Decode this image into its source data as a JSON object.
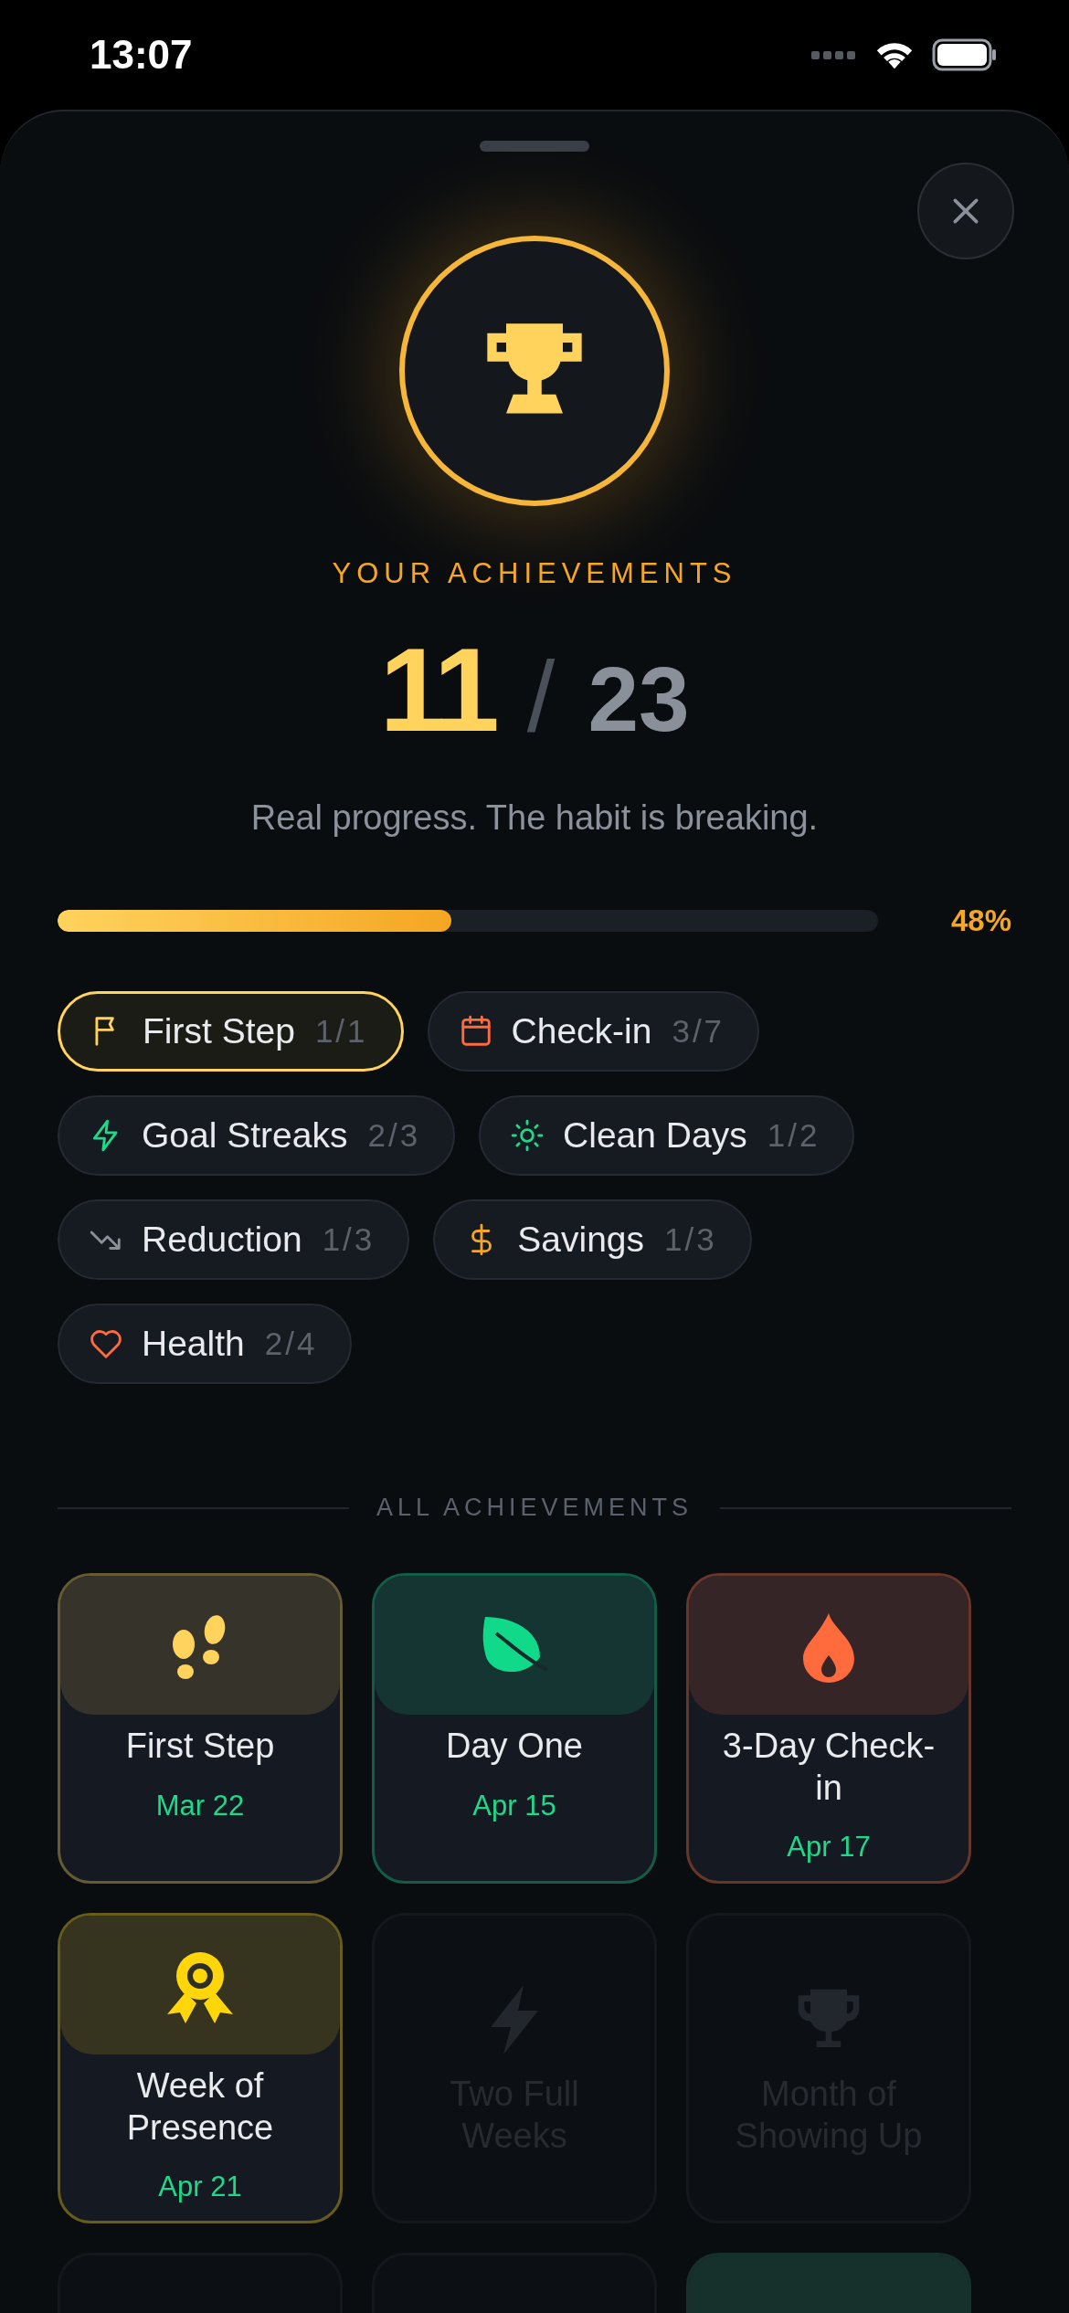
{
  "status_bar": {
    "time": "13:07"
  },
  "header": {
    "title": "YOUR ACHIEVEMENTS",
    "earned": "11",
    "separator": "/",
    "total": "23",
    "subtitle": "Real progress. The habit is breaking."
  },
  "progress": {
    "level": 0.48,
    "reading": "48%"
  },
  "categories": [
    {
      "label": "First Step",
      "count": "1/1",
      "selected": true,
      "color": "#ffd35c"
    },
    {
      "label": "Check-in",
      "count": "3/7",
      "selected": false,
      "color": "#ff6b3d"
    },
    {
      "label": "Goal Streaks",
      "count": "2/3",
      "selected": false,
      "color": "#1ed98a"
    },
    {
      "label": "Clean Days",
      "count": "1/2",
      "selected": false,
      "color": "#1ed98a"
    },
    {
      "label": "Reduction",
      "count": "1/3",
      "selected": false,
      "color": "#8a909a"
    },
    {
      "label": "Savings",
      "count": "1/3",
      "selected": false,
      "color": "#f5a623"
    },
    {
      "label": "Health",
      "count": "2/4",
      "selected": false,
      "color": "#ff6b3d"
    }
  ],
  "section_title": "ALL ACHIEVEMENTS",
  "achievements": [
    {
      "title": "First Step",
      "date": "Mar 22",
      "unlocked": true,
      "color": "#ffd35c"
    },
    {
      "title": "Day One",
      "date": "Apr 15",
      "unlocked": true,
      "color": "#10d98a"
    },
    {
      "title": "3-Day Check-in",
      "date": "Apr 17",
      "unlocked": true,
      "color": "#ff6b3d"
    },
    {
      "title": "Week of Presence",
      "date": "Apr 21",
      "unlocked": true,
      "color": "#ffd60a"
    },
    {
      "title": "Two Full Weeks",
      "unlocked": false
    },
    {
      "title": "Month of Showing Up",
      "unlocked": false
    },
    {
      "unlocked": false
    },
    {
      "unlocked": false
    },
    {
      "unlocked": true,
      "color": "#16302c"
    }
  ]
}
